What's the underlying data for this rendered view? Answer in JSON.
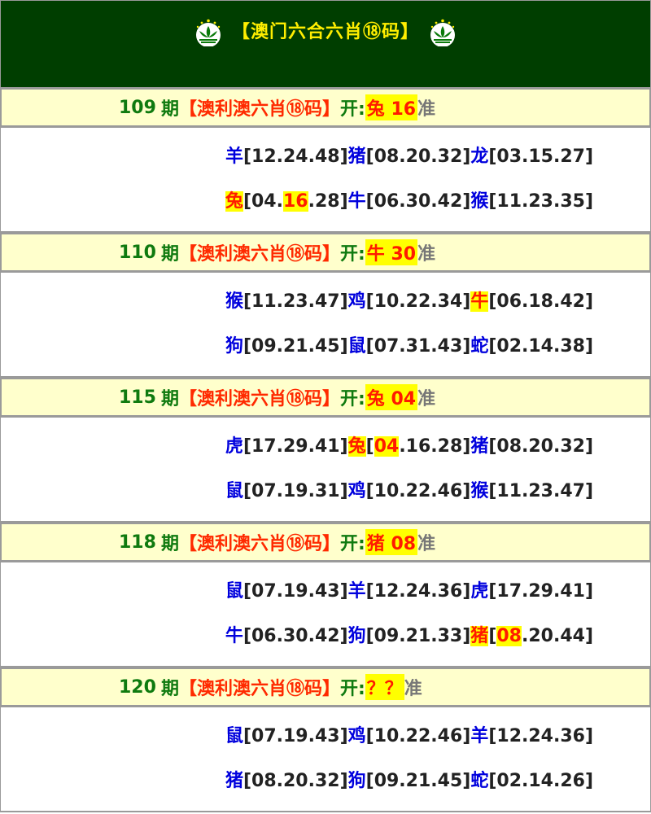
{
  "header": {
    "title": "【澳门六合六肖⑱码】",
    "title_color": "#ffee00",
    "bg_color": "#003e00"
  },
  "labels": {
    "suffix": "期",
    "bracket": "【澳利澳六肖⑱码】",
    "open": "开:",
    "zhun": "准"
  },
  "rows": [
    {
      "issue": "109",
      "result": "兔 16",
      "lines": [
        [
          {
            "z": "羊",
            "n": "[12.24.48]"
          },
          {
            "z": "猪",
            "n": "[08.20.32]"
          },
          {
            "z": "龙",
            "n": "[03.15.27]"
          }
        ],
        [
          {
            "z": "兔",
            "n": "[04.",
            "nh": "16",
            ".n2": ".28]",
            "hit": true,
            "post": ".28]"
          },
          {
            "z": "牛",
            "n": "[06.30.42]"
          },
          {
            "z": "猴",
            "n": "[11.23.35]"
          }
        ]
      ]
    },
    {
      "issue": "110",
      "result": "牛 30",
      "lines": [
        [
          {
            "z": "猴",
            "n": "[11.23.47]"
          },
          {
            "z": "鸡",
            "n": "[10.22.34]"
          },
          {
            "z": "牛",
            "n": "[06.18.42]",
            "hit": true
          }
        ],
        [
          {
            "z": "狗",
            "n": "[09.21.45]"
          },
          {
            "z": "鼠",
            "n": "[07.31.43]"
          },
          {
            "z": "蛇",
            "n": "[02.14.38]"
          }
        ]
      ]
    },
    {
      "issue": "115",
      "result": "兔 04",
      "lines": [
        [
          {
            "z": "虎",
            "n": "[17.29.41]"
          },
          {
            "z": "兔",
            "n": "[",
            "nh": "04",
            "post": ".16.28]",
            "hit": true
          },
          {
            "z": "猪",
            "n": "[08.20.32]"
          }
        ],
        [
          {
            "z": "鼠",
            "n": "[07.19.31]"
          },
          {
            "z": "鸡",
            "n": "[10.22.46]"
          },
          {
            "z": "猴",
            "n": "[11.23.47]"
          }
        ]
      ]
    },
    {
      "issue": "118",
      "result": "猪 08",
      "lines": [
        [
          {
            "z": "鼠",
            "n": "[07.19.43]"
          },
          {
            "z": "羊",
            "n": "[12.24.36]"
          },
          {
            "z": "虎",
            "n": "[17.29.41]"
          }
        ],
        [
          {
            "z": "牛",
            "n": "[06.30.42]"
          },
          {
            "z": "狗",
            "n": "[09.21.33]"
          },
          {
            "z": "猪",
            "n": "[",
            "nh": "08",
            "post": ".20.44]",
            "hit": true
          }
        ]
      ]
    },
    {
      "issue": "120",
      "result": "？？",
      "lines": [
        [
          {
            "z": "鼠",
            "n": "[07.19.43]"
          },
          {
            "z": "鸡",
            "n": "[10.22.46]"
          },
          {
            "z": "羊",
            "n": "[12.24.36]"
          }
        ],
        [
          {
            "z": "猪",
            "n": "[08.20.32]"
          },
          {
            "z": "狗",
            "n": "[09.21.45]"
          },
          {
            "z": "蛇",
            "n": "[02.14.26]"
          }
        ]
      ]
    }
  ]
}
